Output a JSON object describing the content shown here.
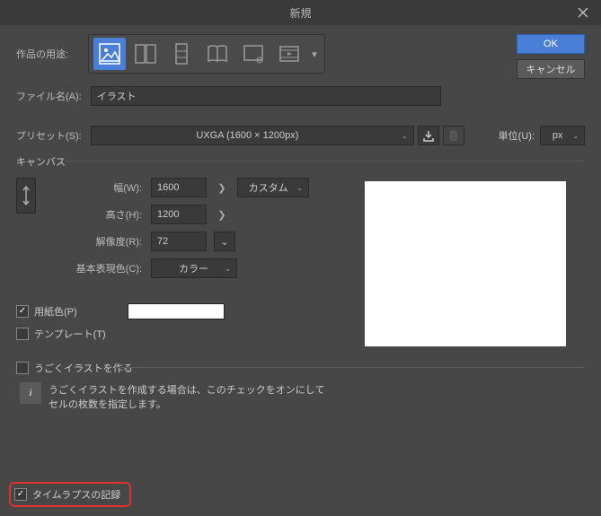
{
  "titlebar": {
    "title": "新規"
  },
  "buttons": {
    "ok": "OK",
    "cancel": "キャンセル"
  },
  "purpose": {
    "label": "作品の用途:"
  },
  "filename": {
    "label": "ファイル名(A):",
    "value": "イラスト"
  },
  "preset": {
    "label": "プリセット(S):",
    "value": "UXGA (1600 × 1200px)"
  },
  "unit": {
    "label": "単位(U):",
    "value": "px"
  },
  "canvas": {
    "legend": "キャンバス",
    "width_label": "幅(W):",
    "width_value": "1600",
    "height_label": "高さ(H):",
    "height_value": "1200",
    "resolution_label": "解像度(R):",
    "resolution_value": "72",
    "colormode_label": "基本表現色(C):",
    "colormode_value": "カラー",
    "custom_label": "カスタム",
    "paper_label": "用紙色(P)",
    "template_label": "テンプレート(T)"
  },
  "anim": {
    "label": "うごくイラストを作る",
    "desc1": "うごくイラストを作成する場合は、このチェックをオンにして",
    "desc2": "セルの枚数を指定します。"
  },
  "timelapse": {
    "label": "タイムラプスの記録"
  }
}
